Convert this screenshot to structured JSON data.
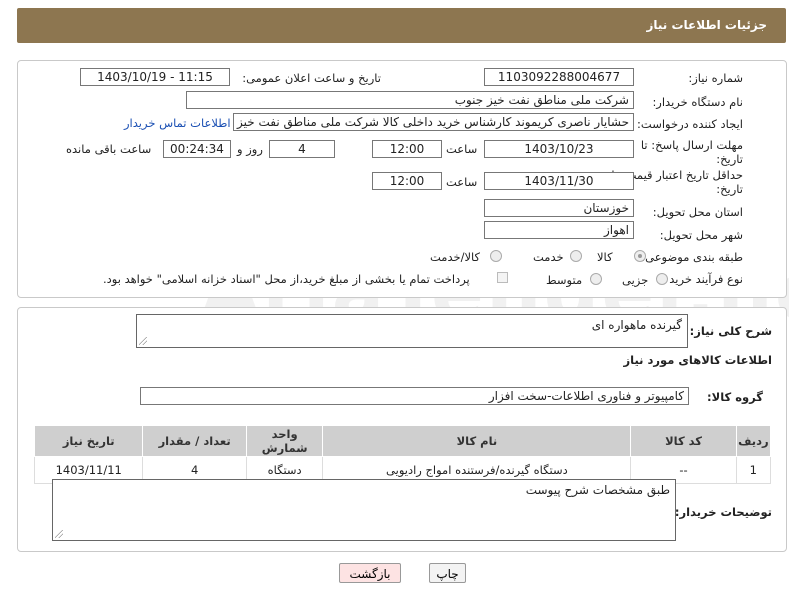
{
  "header": {
    "title": "جزئیات اطلاعات نیاز"
  },
  "fields": {
    "need_number_label": "شماره نیاز:",
    "need_number": "1103092288004677",
    "announce_label": "تاریخ و ساعت اعلان عمومی:",
    "announce_value": "1403/10/19 - 11:15",
    "buyer_org_label": "نام دستگاه خریدار:",
    "buyer_org": "شرکت ملی مناطق نفت خیز جنوب",
    "requester_label": "ایجاد کننده درخواست:",
    "requester": "حشایار ناصری کریموند کارشناس خرید داخلی کالا  شرکت ملی مناطق نفت خیز",
    "contact_link": "اطلاعات تماس خریدار",
    "reply_deadline_label": "مهلت ارسال پاسخ: تا",
    "reply_deadline_label2": "تاریخ:",
    "reply_date": "1403/10/23",
    "time_label": "ساعت",
    "reply_time": "12:00",
    "days_value": "4",
    "days_label": "روز و",
    "remaining_time": "00:24:34",
    "remaining_label": "ساعت باقی مانده",
    "price_validity_label": "حداقل تاریخ اعتبار قیمت: تا",
    "price_validity_label2": "تاریخ:",
    "validity_date": "1403/11/30",
    "validity_time": "12:00",
    "province_label": "استان محل تحویل:",
    "province": "خوزستان",
    "city_label": "شهر محل تحویل:",
    "city": "اهواز",
    "category_label": "طبقه بندی موضوعی:",
    "category_options": [
      "کالا",
      "خدمت",
      "کالا/خدمت"
    ],
    "process_label": "نوع فرآیند خرید :",
    "process_options": [
      "جزیی",
      "متوسط"
    ],
    "payment_note": "پرداخت تمام یا بخشی از مبلغ خرید،از محل \"اسناد خزانه اسلامی\" خواهد بود."
  },
  "description": {
    "label": "شرح کلی نیاز:",
    "value": "گیرنده ماهواره ای"
  },
  "goods": {
    "section_title": "اطلاعات کالاهای مورد نیاز",
    "group_label": "گروه کالا:",
    "group_value": "کامپیوتر و فناوری اطلاعات-سخت افزار",
    "columns": [
      "ردیف",
      "کد کالا",
      "نام کالا",
      "واحد شمارش",
      "تعداد / مقدار",
      "تاریخ نیاز"
    ],
    "rows": [
      [
        "1",
        "--",
        "دستگاه گیرنده/فرستنده امواج رادیویی",
        "دستگاه",
        "4",
        "1403/11/11"
      ]
    ]
  },
  "buyer_notes": {
    "label": "توضیحات خریدار:",
    "value": "طبق مشخصات شرح پیوست"
  },
  "buttons": {
    "print": "چاپ",
    "back": "بازگشت"
  },
  "colors": {
    "header_bg": "#8d7650",
    "link": "#1a4fb3",
    "back_button_bg": "#fde3e3"
  }
}
